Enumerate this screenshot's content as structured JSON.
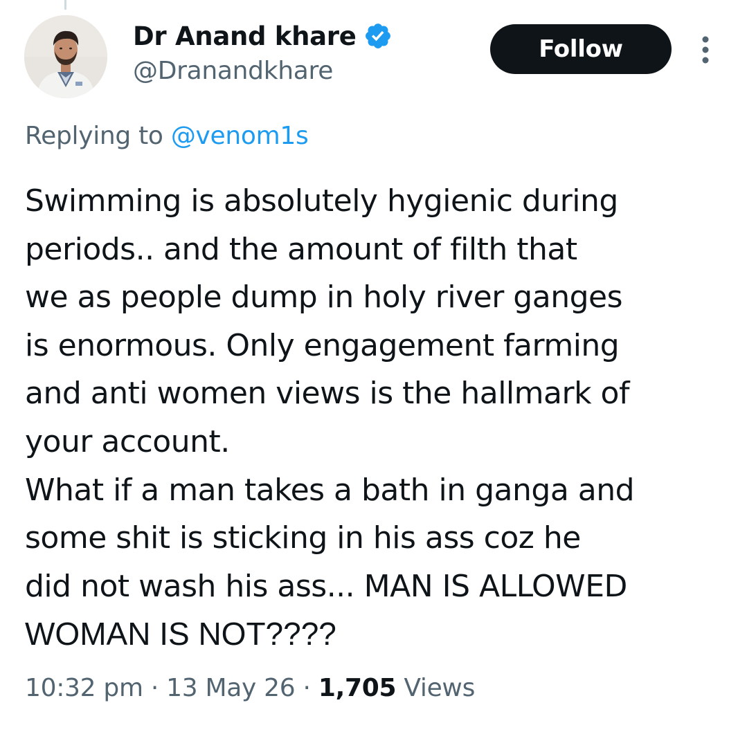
{
  "author": {
    "display_name": "Dr Anand khare",
    "handle": "@Dranandkhare",
    "verified": true
  },
  "follow_button": {
    "label": "Follow"
  },
  "more_menu": {
    "icon": "more-vertical-icon"
  },
  "reply": {
    "prefix": "Replying to ",
    "mention": "@venom1s"
  },
  "tweet": {
    "lines": [
      "Swimming is absolutely hygienic during",
      "periods.. and the amount of filth that",
      "we as people dump in holy river ganges",
      "is enormous. Only engagement farming",
      "and anti women views is the hallmark of",
      "your account.",
      "What if a man takes a bath in ganga and",
      "some shit is sticking in his ass coz he",
      "did not wash his ass... MAN IS ALLOWED",
      "WOMAN IS NOT????"
    ]
  },
  "meta": {
    "time": "10:32 pm",
    "separator": " · ",
    "date": "13 May 26",
    "views_count": "1,705",
    "views_label": " Views"
  },
  "colors": {
    "text_primary": "#0f1419",
    "text_secondary": "#536471",
    "accent": "#1d9bf0",
    "button_bg": "#0f1419",
    "button_text": "#ffffff",
    "background": "#ffffff"
  }
}
